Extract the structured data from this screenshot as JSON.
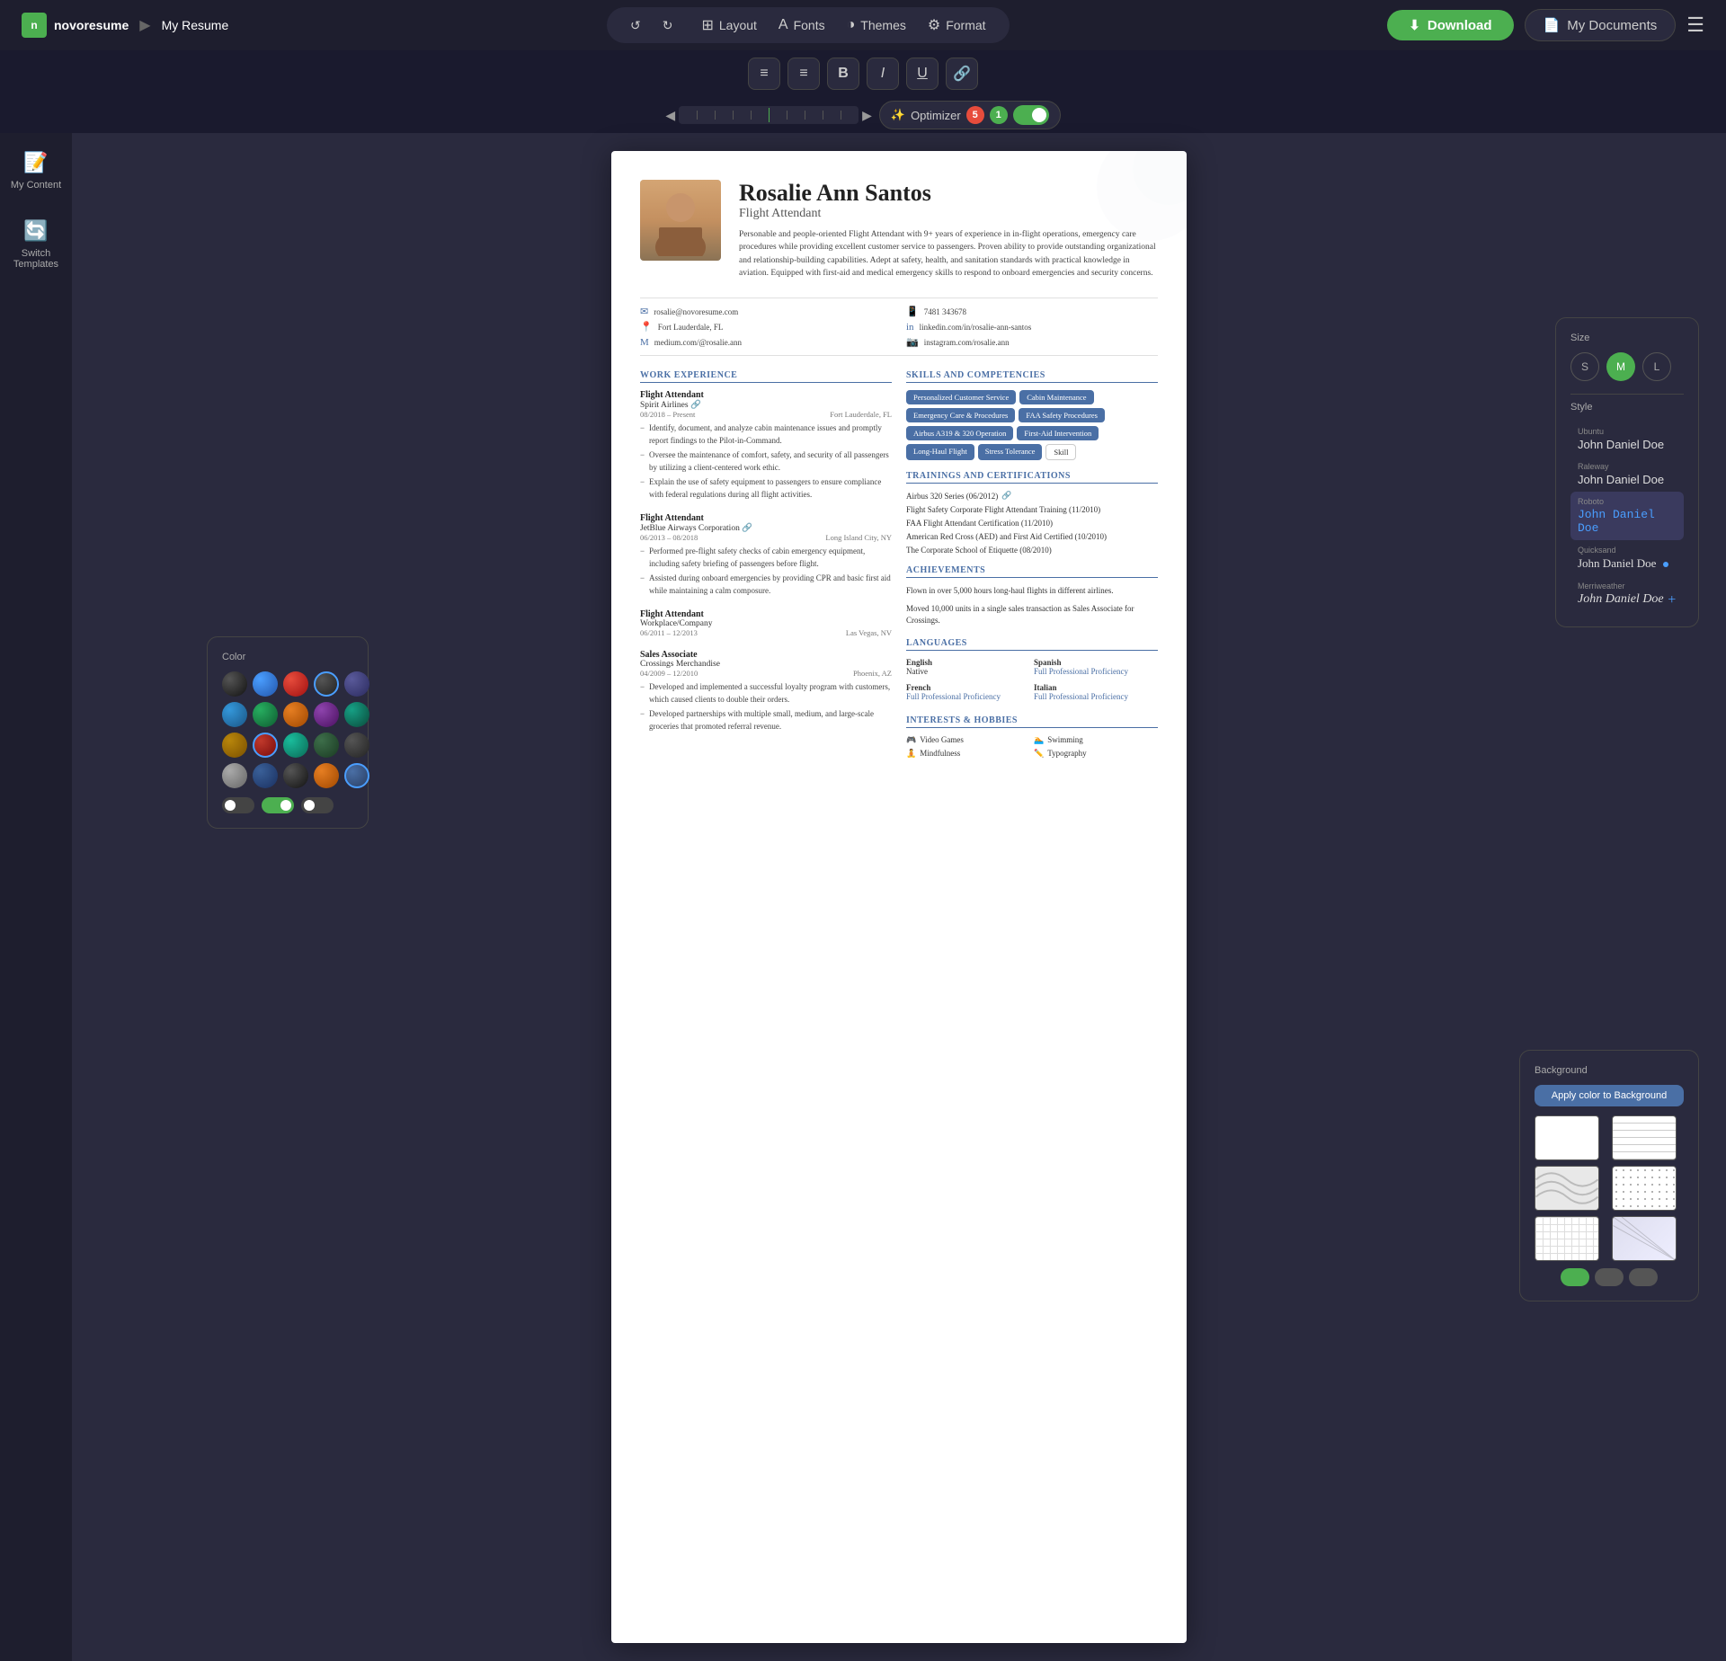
{
  "app": {
    "logo_text": "novoresume",
    "breadcrumb_sep": "▶",
    "page_name": "My Resume"
  },
  "top_nav": {
    "undo_label": "↺",
    "redo_label": "↻",
    "layout_label": "Layout",
    "fonts_label": "Fonts",
    "themes_label": "Themes",
    "format_label": "Format",
    "download_label": "Download",
    "my_docs_label": "My Documents"
  },
  "format_toolbar": {
    "align_left": "≡",
    "align_center": "≡",
    "bold": "B",
    "italic": "I",
    "underline": "U",
    "link": "🔗"
  },
  "optimizer": {
    "label": "Optimizer",
    "red_count": "5",
    "green_count": "1"
  },
  "left_sidebar": {
    "my_content_label": "My Content",
    "switch_templates_label": "Switch Templates"
  },
  "size_popup": {
    "title": "Size",
    "options": [
      "S",
      "M",
      "L"
    ],
    "active": "M",
    "style_label": "Style"
  },
  "fonts_popup": {
    "title": "Style",
    "fonts": [
      {
        "name": "Ubuntu",
        "preview": "John Daniel Doe"
      },
      {
        "name": "Raleway",
        "preview": "John Daniel Doe"
      },
      {
        "name": "Roboto",
        "preview": "John Daniel Doe",
        "active": true
      },
      {
        "name": "Quicksand",
        "preview": "John Daniel Doe"
      },
      {
        "name": "Merriweather",
        "preview": "John Daniel Doe"
      }
    ]
  },
  "color_popup": {
    "title": "Color",
    "swatches": [
      "#1a1a2e",
      "#2c3e7a",
      "#c0392b",
      "#3d3d3d",
      "#4a4a6a",
      "#2980b9",
      "#27ae60",
      "#e67e22",
      "#8e44ad",
      "#16a085",
      "#2ecc71",
      "#e74c3c",
      "#3498db",
      "#1abc9c",
      "#f39c12",
      "#ecf0f1",
      "#bdc3c7",
      "#95a5a6",
      "#7f8c8d",
      "#2c3e50"
    ]
  },
  "background_popup": {
    "title": "Background",
    "apply_btn": "Apply color to Background"
  },
  "resume": {
    "name": "Rosalie Ann Santos",
    "job_title": "Flight Attendant",
    "summary": "Personable and people-oriented Flight Attendant with 9+ years of experience in in-flight operations, emergency care procedures while providing excellent customer service to passengers. Proven ability to provide outstanding organizational and relationship-building capabilities. Adept at safety, health, and sanitation standards with practical knowledge in aviation. Equipped with first-aid and medical emergency skills to respond to onboard emergencies and security concerns.",
    "contact": {
      "email": "rosalie@novoresume.com",
      "phone": "7481 343678",
      "location": "Fort Lauderdale, FL",
      "linkedin": "linkedin.com/in/rosalie-ann-santos",
      "medium": "medium.com/@rosalie.ann",
      "instagram": "instagram.com/rosalie.ann"
    },
    "work_experience_title": "WORK EXPERIENCE",
    "jobs": [
      {
        "title": "Flight Attendant",
        "company": "Spirit Airlines",
        "dates": "08/2018 – Present",
        "location": "Fort Lauderdale, FL",
        "bullets": [
          "Identify, document, and analyze cabin maintenance issues and promptly report findings to the Pilot-in-Command.",
          "Oversee the maintenance of comfort, safety, and security of all passengers by utilizing a client-centered work ethic.",
          "Explain the use of safety equipment to passengers to ensure compliance with federal regulations during all flight activities."
        ]
      },
      {
        "title": "Flight Attendant",
        "company": "JetBlue Airways Corporation",
        "dates": "06/2013 – 08/2018",
        "location": "Long Island City, NY",
        "bullets": [
          "Performed pre-flight safety checks of cabin emergency equipment, including safety briefing of passengers before flight.",
          "Assisted during onboard emergencies by providing CPR and basic first aid while maintaining a calm composure."
        ]
      },
      {
        "title": "Flight Attendant",
        "company": "Workplace/Company",
        "dates": "06/2011 – 12/2013",
        "location": "Las Vegas, NV",
        "bullets": []
      },
      {
        "title": "Sales Associate",
        "company": "Crossings Merchandise",
        "dates": "04/2009 – 12/2010",
        "location": "Phoenix, AZ",
        "bullets": [
          "Developed and implemented a successful loyalty program with customers, which caused clients to double their orders.",
          "Developed partnerships with multiple small, medium, and large-scale groceries that promoted referral revenue."
        ]
      }
    ],
    "skills_title": "SKILLS AND COMPETENCIES",
    "skills": [
      "Personalized Customer Service",
      "Cabin Maintenance",
      "Emergency Care & Procedures",
      "FAA Safety Procedures",
      "Airbus A319 & 320 Operation",
      "First-Aid Intervention",
      "Long-Haul Flight",
      "Stress Tolerance",
      "Skill"
    ],
    "trainings_title": "TRAININGS AND CERTIFICATIONS",
    "trainings": [
      "Airbus 320 Series (06/2012) 🔗",
      "Flight Safety Corporate Flight Attendant Training (11/2010)",
      "FAA Flight Attendant Certification (11/2010)",
      "American Red Cross (AED) and First Aid Certified (10/2010)",
      "The Corporate School of Etiquette (08/2010)"
    ],
    "achievements_title": "ACHIEVEMENTS",
    "achievements": [
      "Flown in over 5,000 hours long-haul flights in different airlines.",
      "Moved 10,000 units in a single sales transaction as Sales Associate for Crossings."
    ],
    "languages_title": "LANGUAGES",
    "languages": [
      {
        "name": "English",
        "level": "Native"
      },
      {
        "name": "Spanish",
        "level": "Full Professional Proficiency"
      },
      {
        "name": "French",
        "level": "Full Professional Proficiency"
      },
      {
        "name": "Italian",
        "level": "Full Professional Proficiency"
      }
    ],
    "interests_title": "INTERESTS & HOBBIES",
    "interests": [
      {
        "icon": "🎮",
        "name": "Video Games"
      },
      {
        "icon": "🏊",
        "name": "Swimming"
      },
      {
        "icon": "🧘",
        "name": "Mindfulness"
      },
      {
        "icon": "✏️",
        "name": "Typography"
      }
    ]
  }
}
